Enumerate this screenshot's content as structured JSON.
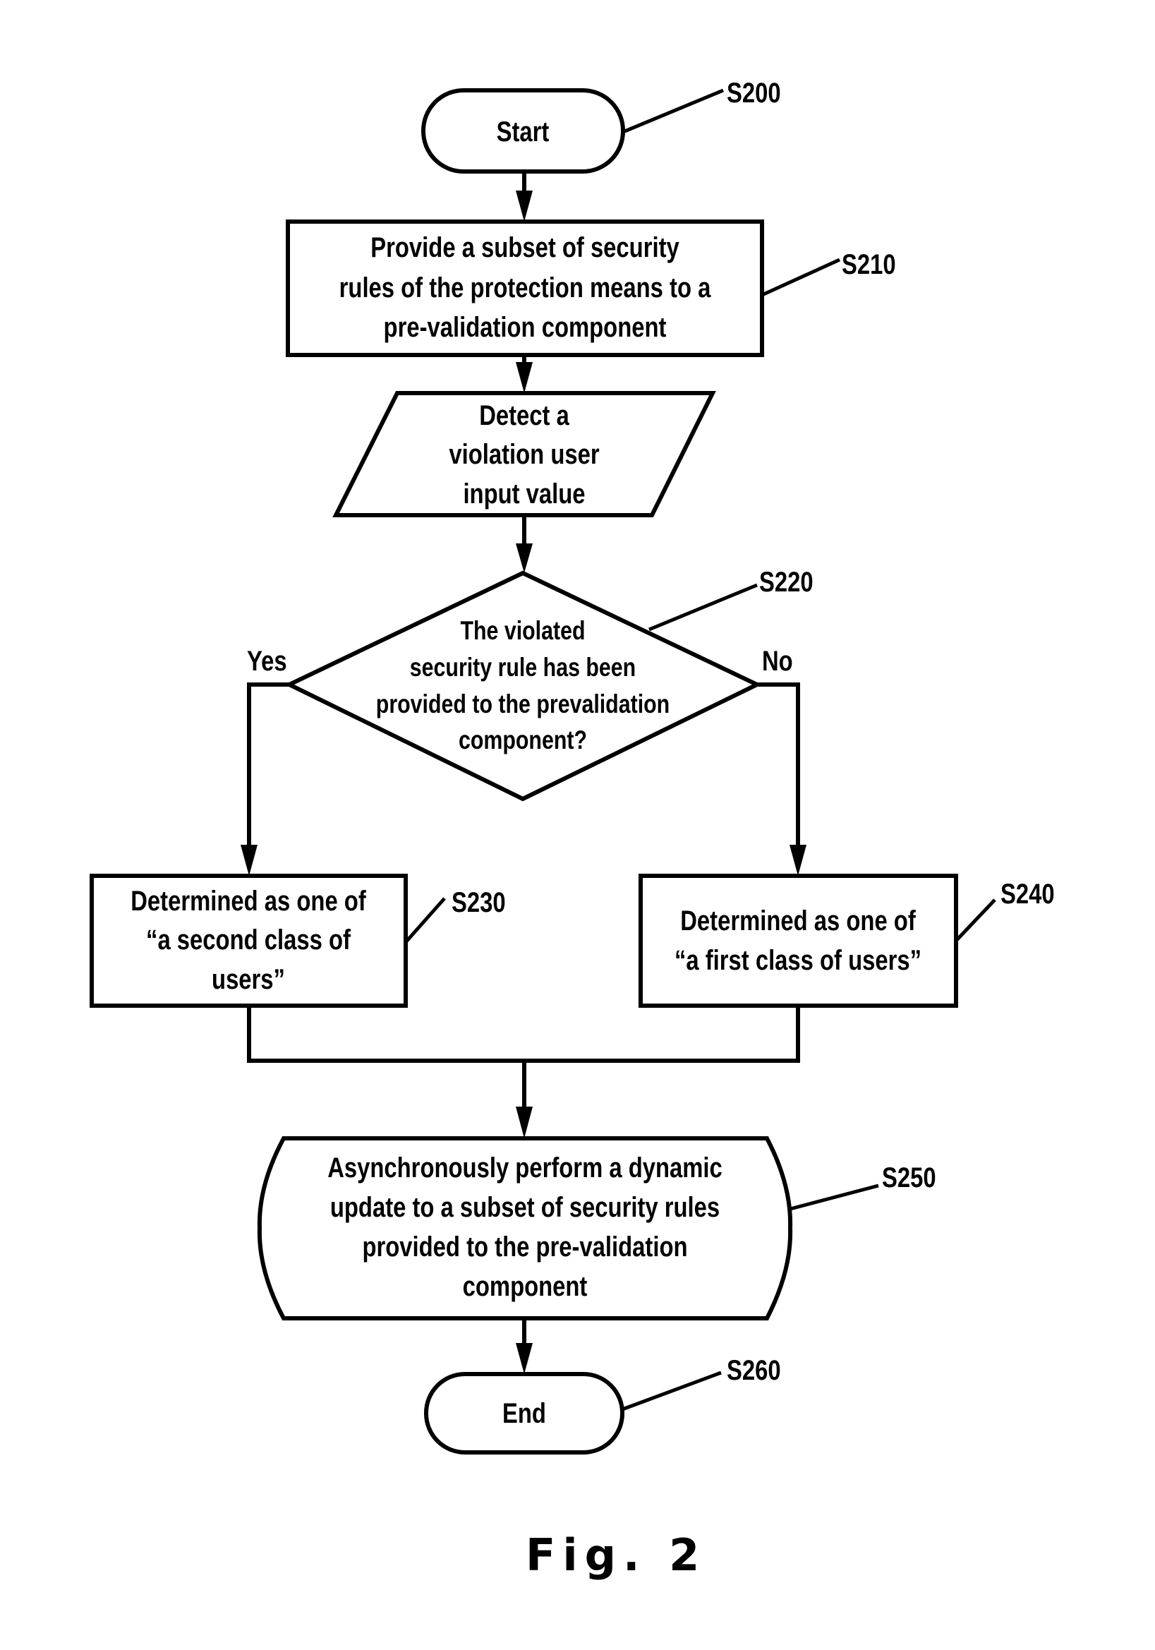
{
  "figure": {
    "caption": "Fig. 2",
    "nodes": {
      "start": {
        "label": "S200",
        "lines": [
          "Start"
        ]
      },
      "provide": {
        "label": "S210",
        "lines": [
          "Provide a subset of security",
          "rules of the protection means to a",
          "pre-validation component"
        ]
      },
      "detect": {
        "lines": [
          "Detect a",
          "violation user",
          "input value"
        ]
      },
      "decision": {
        "label": "S220",
        "lines": [
          "The violated",
          "security rule has been",
          "provided to the prevalidation",
          "component?"
        ]
      },
      "second_class": {
        "label": "S230",
        "lines": [
          "Determined as one of",
          "“a second class of",
          "users”"
        ]
      },
      "first_class": {
        "label": "S240",
        "lines": [
          "Determined as one of",
          "“a first class of users”"
        ]
      },
      "update": {
        "label": "S250",
        "lines": [
          "Asynchronously perform a dynamic",
          "update to a subset of security rules",
          "provided to the pre-validation",
          "component"
        ]
      },
      "end": {
        "label": "S260",
        "lines": [
          "End"
        ]
      }
    },
    "branches": {
      "yes": "Yes",
      "no": "No"
    }
  }
}
